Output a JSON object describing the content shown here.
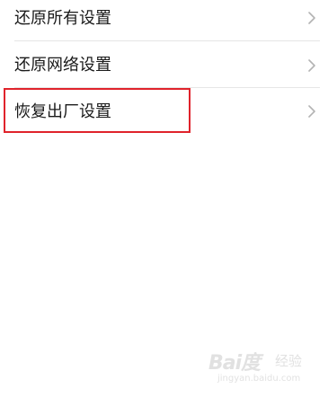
{
  "settings": {
    "items": [
      {
        "label": "还原所有设置"
      },
      {
        "label": "还原网络设置"
      },
      {
        "label": "恢复出厂设置"
      }
    ]
  },
  "annotation": {
    "highlight_color": "#e0232b"
  },
  "watermark": {
    "logo": "Bai度",
    "brand": "经验",
    "url": "jingyan.baidu.com"
  }
}
